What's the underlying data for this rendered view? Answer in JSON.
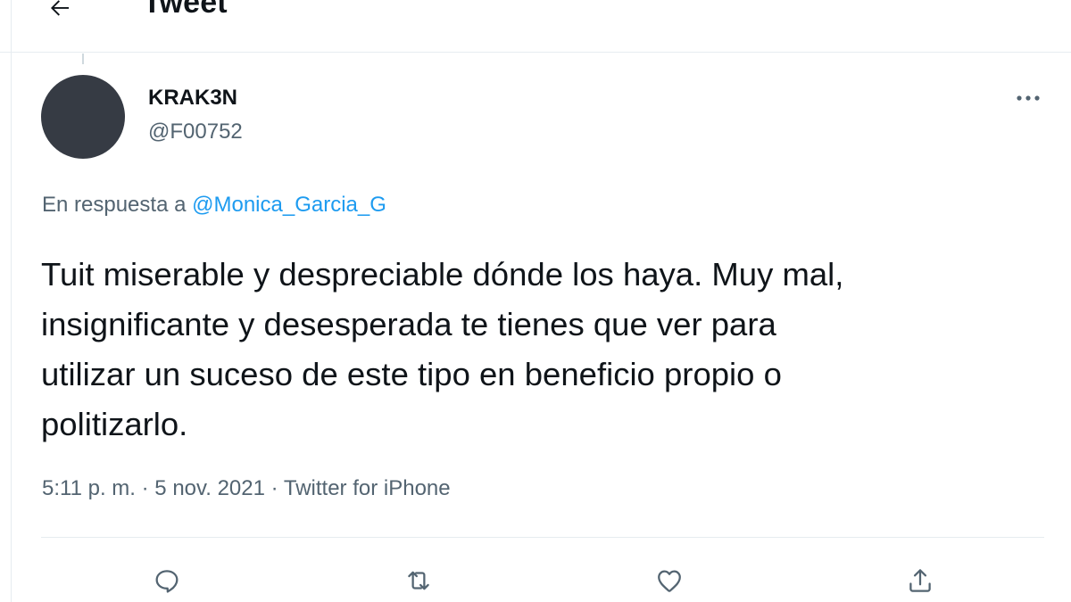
{
  "header": {
    "title": "Tweet",
    "back_icon": "arrow-left-icon"
  },
  "tweet": {
    "display_name": "KRAK3N",
    "handle": "@F00752",
    "reply_prefix": "En respuesta a",
    "reply_to": "@Monica_Garcia_G",
    "text_lines": [
      "Tuit miserable y despreciable dónde los haya. Muy mal,",
      "insignificante y desesperada te tienes que ver para",
      "utilizar un suceso de este tipo en beneficio propio o",
      "politizarlo."
    ],
    "time": "5:11 p. m.",
    "separator": "·",
    "date": "5 nov. 2021",
    "source": "Twitter for iPhone"
  },
  "actions": [
    {
      "name": "reply",
      "icon": "reply-icon"
    },
    {
      "name": "retweet",
      "icon": "retweet-icon"
    },
    {
      "name": "like",
      "icon": "heart-icon"
    },
    {
      "name": "share",
      "icon": "share-icon"
    }
  ],
  "colors": {
    "text": "#0f1419",
    "secondary": "#536471",
    "link": "#1d9bf0",
    "border": "#e6ecf0",
    "avatar": "#363b44"
  }
}
